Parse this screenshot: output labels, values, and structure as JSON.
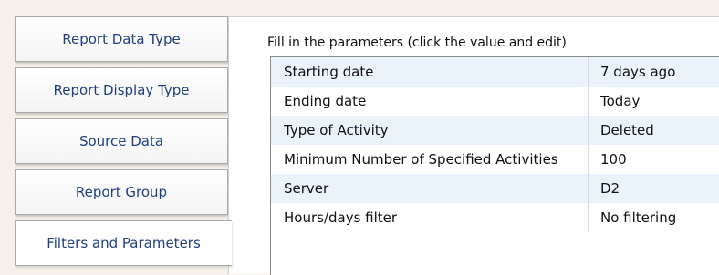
{
  "tabs": [
    {
      "label": "Report Data Type"
    },
    {
      "label": "Report Display Type"
    },
    {
      "label": "Source Data"
    },
    {
      "label": "Report Group"
    },
    {
      "label": "Filters and Parameters"
    }
  ],
  "parameters": {
    "instruction": "Fill in the parameters (click the value and edit)",
    "rows": [
      {
        "name": "Starting date",
        "value": "7 days ago"
      },
      {
        "name": "Ending date",
        "value": "Today"
      },
      {
        "name": "Type of Activity",
        "value": "Deleted"
      },
      {
        "name": "Minimum Number of Specified Activities",
        "value": "100"
      },
      {
        "name": "Server",
        "value": "D2"
      },
      {
        "name": "Hours/days filter",
        "value": "No filtering"
      }
    ]
  },
  "colors": {
    "tab_text": "#1f3f7f",
    "alt_row": "#eaf2fb",
    "background": "#f5f1ea"
  }
}
